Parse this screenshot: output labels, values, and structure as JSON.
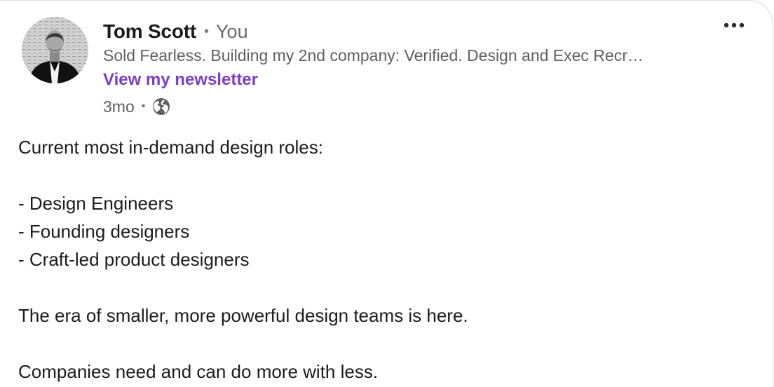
{
  "post": {
    "author": {
      "name": "Tom Scott",
      "relation": "You",
      "headline": "Sold Fearless. Building my 2nd company: Verified. Design and Exec Recr…",
      "newsletter_link": "View my newsletter",
      "avatar_icon": "profile-photo"
    },
    "meta": {
      "time": "3mo",
      "visibility_icon": "globe-icon"
    },
    "more_icon": "ellipsis-icon",
    "body": {
      "intro": "Current most in-demand design roles:",
      "roles": [
        "- Design Engineers",
        "- Founding designers",
        "- Craft-led product designers"
      ],
      "statement": "The era of smaller, more powerful design teams is here.",
      "closing": "Companies need and can do more with less."
    }
  },
  "colors": {
    "link": "#7c3fc6",
    "text": "#1c1c1c",
    "muted": "#5f5f5f"
  }
}
